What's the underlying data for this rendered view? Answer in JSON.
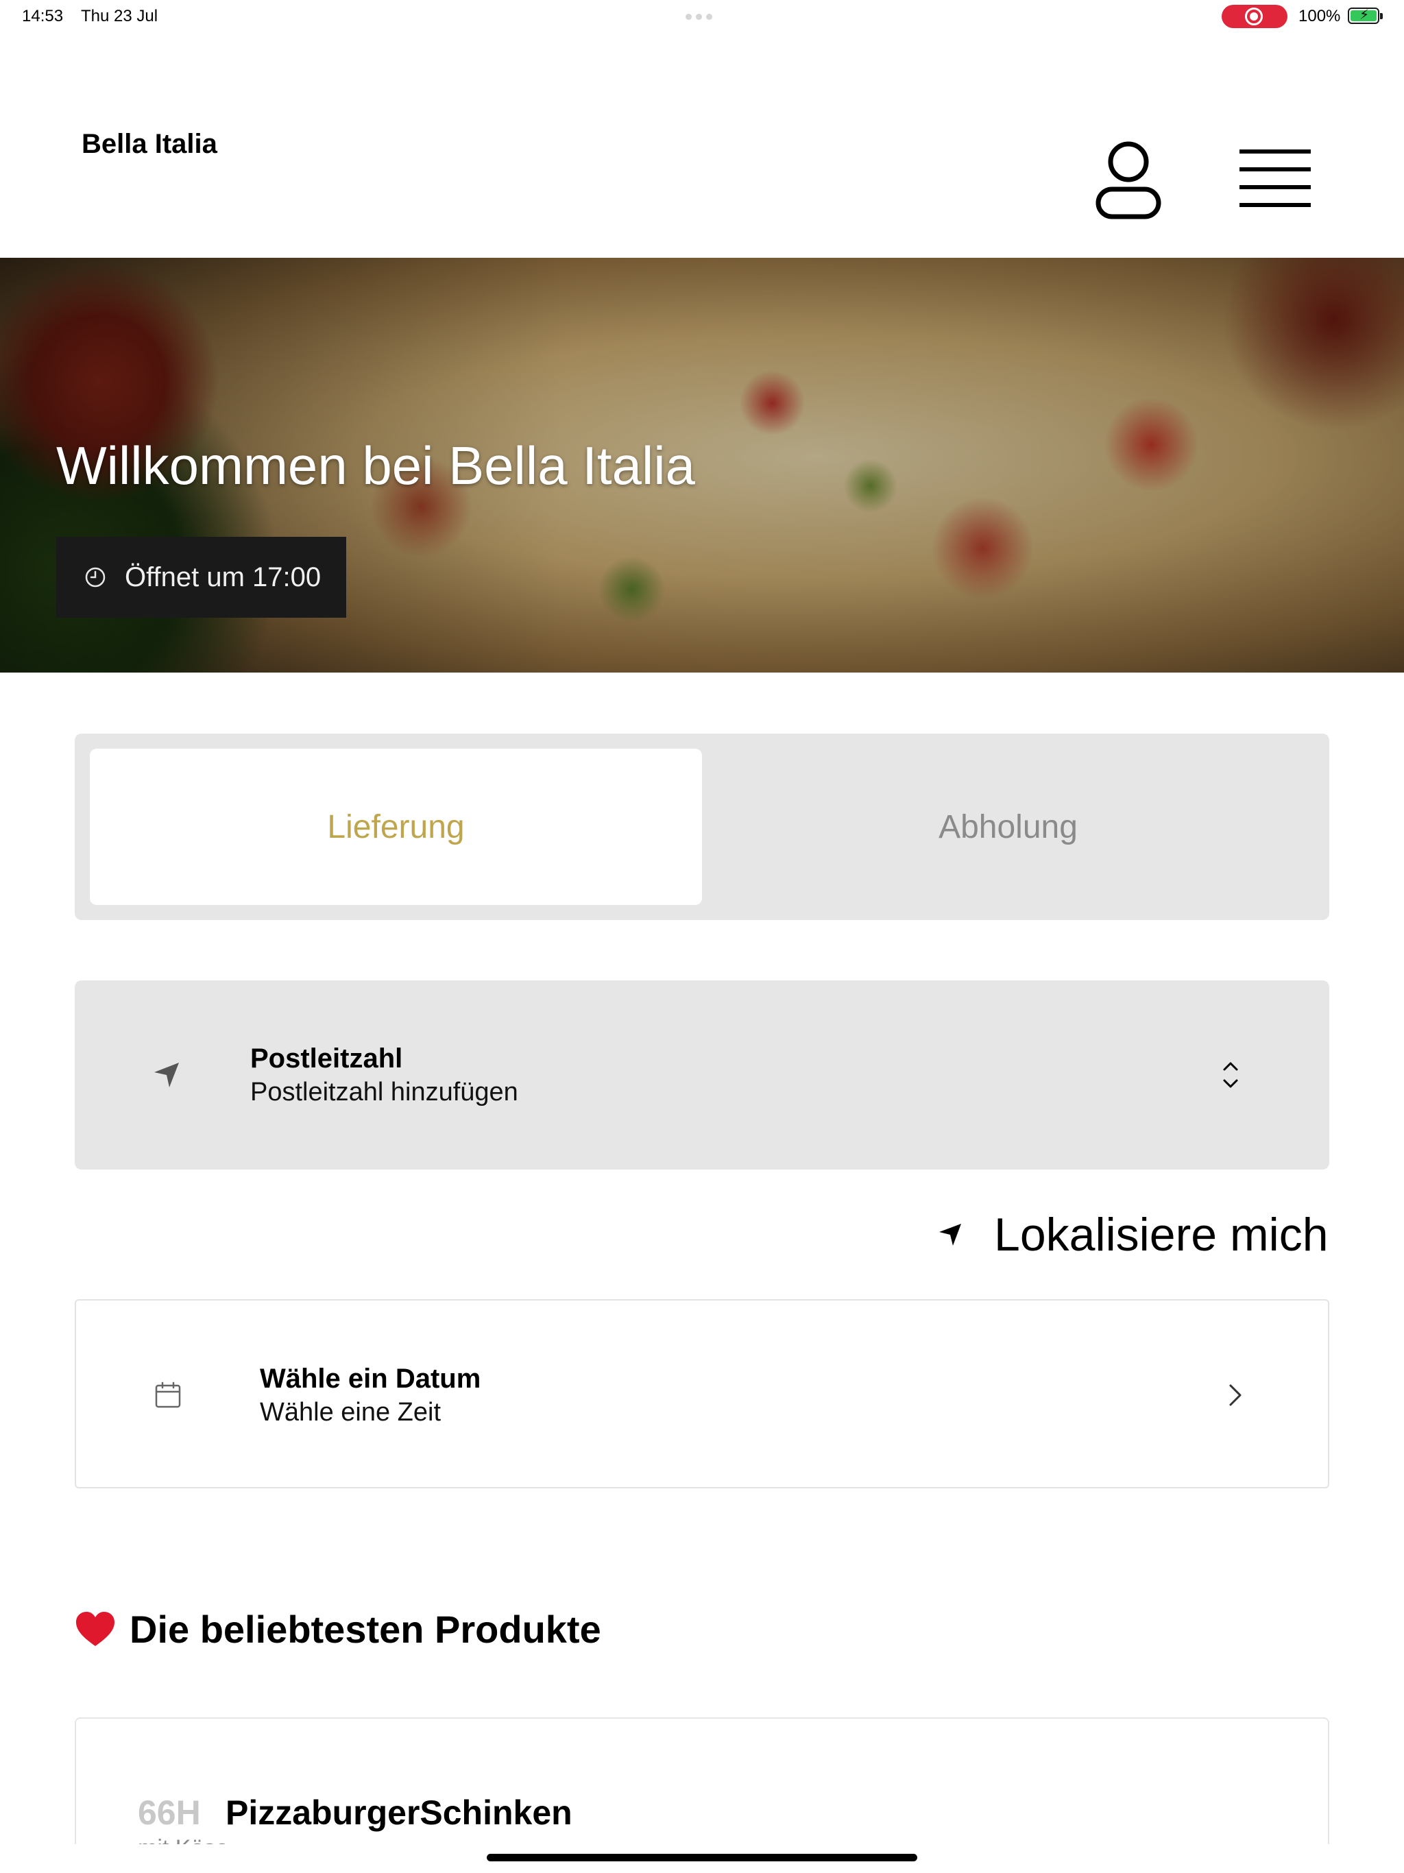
{
  "status_bar": {
    "time": "14:53",
    "date": "Thu 23 Jul",
    "battery": "100%",
    "recording_color": "#e0263a"
  },
  "header": {
    "brand": "Bella Italia",
    "profile_icon": "user-icon",
    "menu_icon": "hamburger-menu-icon"
  },
  "hero": {
    "title": "Willkommen bei Bella Italia",
    "opening_text": "Öffnet um 17:00",
    "opening_icon": "clock-icon"
  },
  "order_mode": {
    "tabs": [
      {
        "label": "Lieferung",
        "selected": true
      },
      {
        "label": "Abholung",
        "selected": false
      }
    ],
    "accent_color": "#bfa54c"
  },
  "postcode": {
    "title": "Postleitzahl",
    "placeholder": "Postleitzahl hinzufügen",
    "icon": "location-arrow-icon"
  },
  "locate": {
    "label": "Lokalisiere mich",
    "icon": "location-arrow-icon"
  },
  "schedule": {
    "title": "Wähle ein Datum",
    "subtitle": "Wähle eine Zeit",
    "icon": "calendar-icon"
  },
  "popular": {
    "title": "Die beliebtesten Produkte",
    "icon": "heart-icon",
    "products": [
      {
        "code": "66H",
        "name": "PizzaburgerSchinken",
        "desc": "mit Käse"
      }
    ]
  }
}
